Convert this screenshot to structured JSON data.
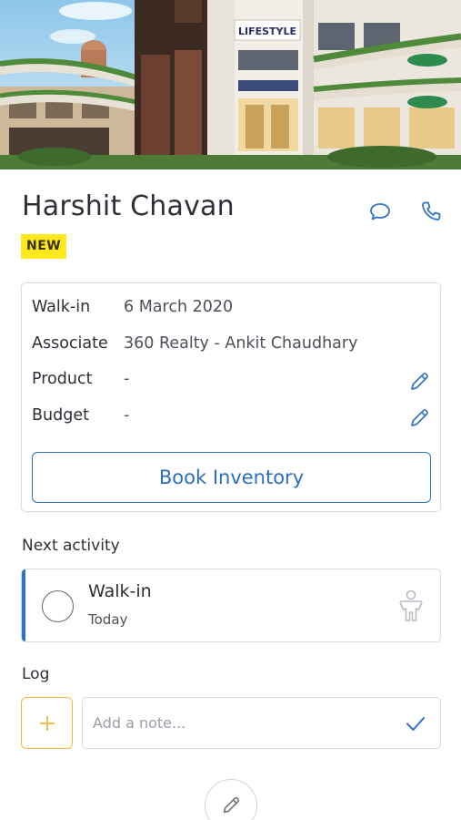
{
  "lead": {
    "name": "Harshit Chavan",
    "status_badge": "NEW"
  },
  "header_icons": [
    "chat-bubble-icon",
    "phone-icon"
  ],
  "details": {
    "rows": [
      {
        "label": "Walk-in",
        "value": "6 March 2020",
        "editable": false
      },
      {
        "label": "Associate",
        "value": "360 Realty - Ankit Chaudhary",
        "editable": false
      },
      {
        "label": "Product",
        "value": "-",
        "editable": true
      },
      {
        "label": "Budget",
        "value": "-",
        "editable": true
      }
    ],
    "book_button_label": "Book Inventory"
  },
  "next_activity": {
    "section_title": "Next activity",
    "title": "Walk-in",
    "when": "Today",
    "icon": "person-walk-in-icon"
  },
  "log": {
    "section_title": "Log",
    "note_placeholder": "Add a note..."
  },
  "shop_signs": {
    "lifestyle": "LIFESTYLE"
  },
  "colors": {
    "accent_blue": "#2f74c4",
    "badge_yellow": "#ffe81c",
    "add_button_border": "#f0b93a",
    "border_gray": "#d8dbe0"
  }
}
